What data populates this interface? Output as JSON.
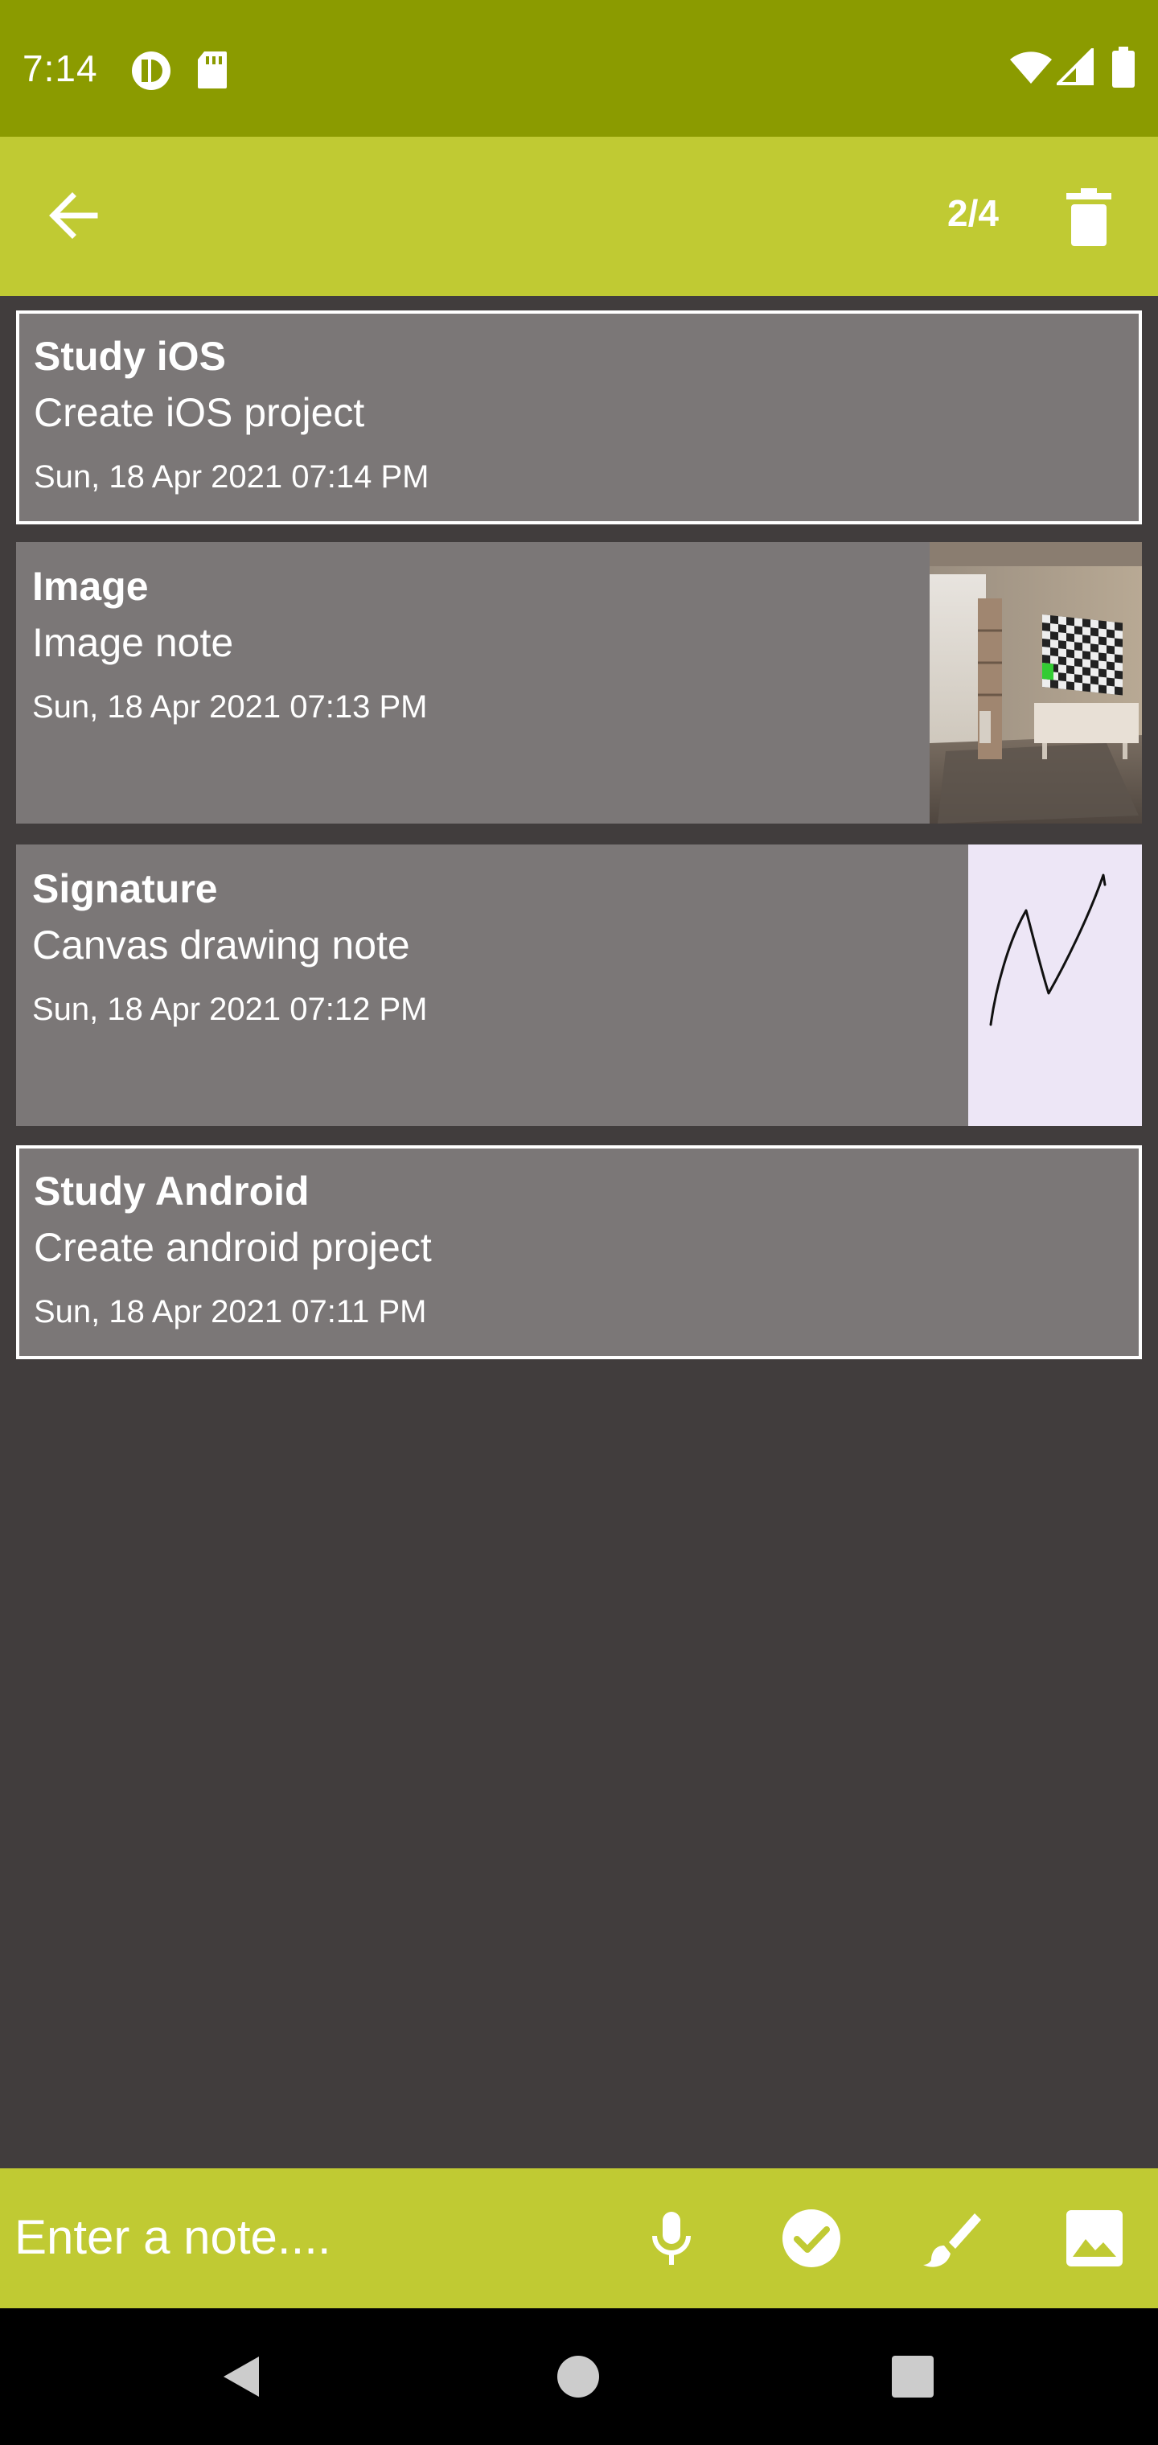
{
  "status_bar": {
    "time": "7:14",
    "icons": [
      "rocket-app-icon",
      "sd-card-icon",
      "wifi-icon",
      "signal-icon",
      "battery-icon"
    ]
  },
  "app_bar": {
    "counter": "2/4",
    "back_icon": "arrow-back-icon",
    "delete_icon": "trash-icon"
  },
  "notes": [
    {
      "title": "Study iOS",
      "body": "Create iOS project",
      "date": "Sun, 18 Apr 2021  07:14 PM",
      "selected": true,
      "thumbnail": null
    },
    {
      "title": "Image",
      "body": "Image note",
      "date": "Sun, 18 Apr 2021  07:13 PM",
      "selected": false,
      "thumbnail": "room-photo"
    },
    {
      "title": "Signature",
      "body": "Canvas drawing note",
      "date": "Sun, 18 Apr 2021  07:12 PM",
      "selected": false,
      "thumbnail": "signature-drawing"
    },
    {
      "title": "Study Android",
      "body": "Create android project",
      "date": "Sun, 18 Apr 2021  07:11 PM",
      "selected": true,
      "thumbnail": null
    }
  ],
  "bottom_bar": {
    "input_placeholder": "Enter a note....",
    "input_value": "",
    "icons": [
      "microphone-icon",
      "check-circle-icon",
      "brush-icon",
      "image-icon"
    ]
  },
  "nav_bar": {
    "icons": [
      "nav-back-icon",
      "nav-home-icon",
      "nav-recents-icon"
    ]
  },
  "colors": {
    "status_bar": "#8b9b00",
    "accent": "#c0ca33",
    "background": "#413d3d",
    "card": "#7b7777",
    "signature_bg": "#ede6f6"
  }
}
